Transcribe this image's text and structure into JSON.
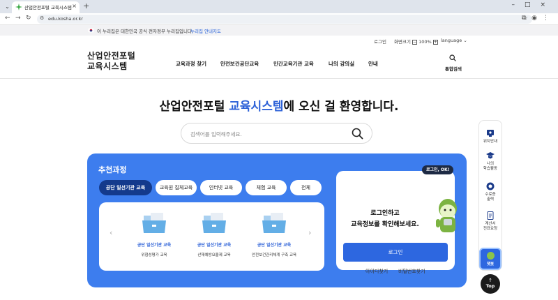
{
  "browser": {
    "tab_title": "산업안전포털 교육시스템",
    "url": "edu.kosha.or.kr"
  },
  "gov_banner": {
    "text": "이 누리집은 대한민국 공식 전자정부 누리집입니다.",
    "link": "누리집 안내지도"
  },
  "util": {
    "login": "로그인",
    "zoom_label": "화면크기",
    "zoom_value": "100%",
    "zoom_minus": "−",
    "zoom_plus": "+",
    "language": "language"
  },
  "header": {
    "logo_line1": "산업안전포털",
    "logo_line2": "교육시스템",
    "nav": [
      "교육과정 찾기",
      "안전보건공단교육",
      "민간교육기관 교육",
      "나의 강의실",
      "안내"
    ],
    "search_label": "통합검색"
  },
  "hero": {
    "title_pre": "산업안전포털 ",
    "title_highlight": "교육시스템",
    "title_post": "에 오신 걸 환영합니다.",
    "search_placeholder": "검색어를 입력해주세요."
  },
  "recommend": {
    "title": "추천과정",
    "tabs": [
      "공단 일선기관 교육",
      "교육원 집체교육",
      "인터넷 교육",
      "체험 교육",
      "전체"
    ],
    "active_tab": 0,
    "cards": [
      {
        "category": "공단 일선기관 교육",
        "name": "위험성평가 교육"
      },
      {
        "category": "공단 일선기관 교육",
        "name": "산재예방요율제 교육"
      },
      {
        "category": "공단 일선기관 교육",
        "name": "안전보건관리체계 구축 교육"
      }
    ]
  },
  "login_box": {
    "badge": "로그인, OK!",
    "line1": "로그인하고",
    "line2": "교육정보를 확인해보세요.",
    "button": "로그인",
    "find_id": "아이디찾기",
    "find_pw": "비밀번호찾기"
  },
  "quick_menu": {
    "items": [
      {
        "label1": "위치안내",
        "label2": ""
      },
      {
        "label1": "나의",
        "label2": "학습활동"
      },
      {
        "label1": "수료증",
        "label2": "출력"
      },
      {
        "label1": "계산서",
        "label2": "전표요청"
      }
    ],
    "chatbot": "챗봇",
    "top_arrow": "↑",
    "top": "Top"
  },
  "colors": {
    "brand_blue": "#3d7dee",
    "dark_navy": "#143a8c",
    "highlight_text": "#2f63d8"
  }
}
